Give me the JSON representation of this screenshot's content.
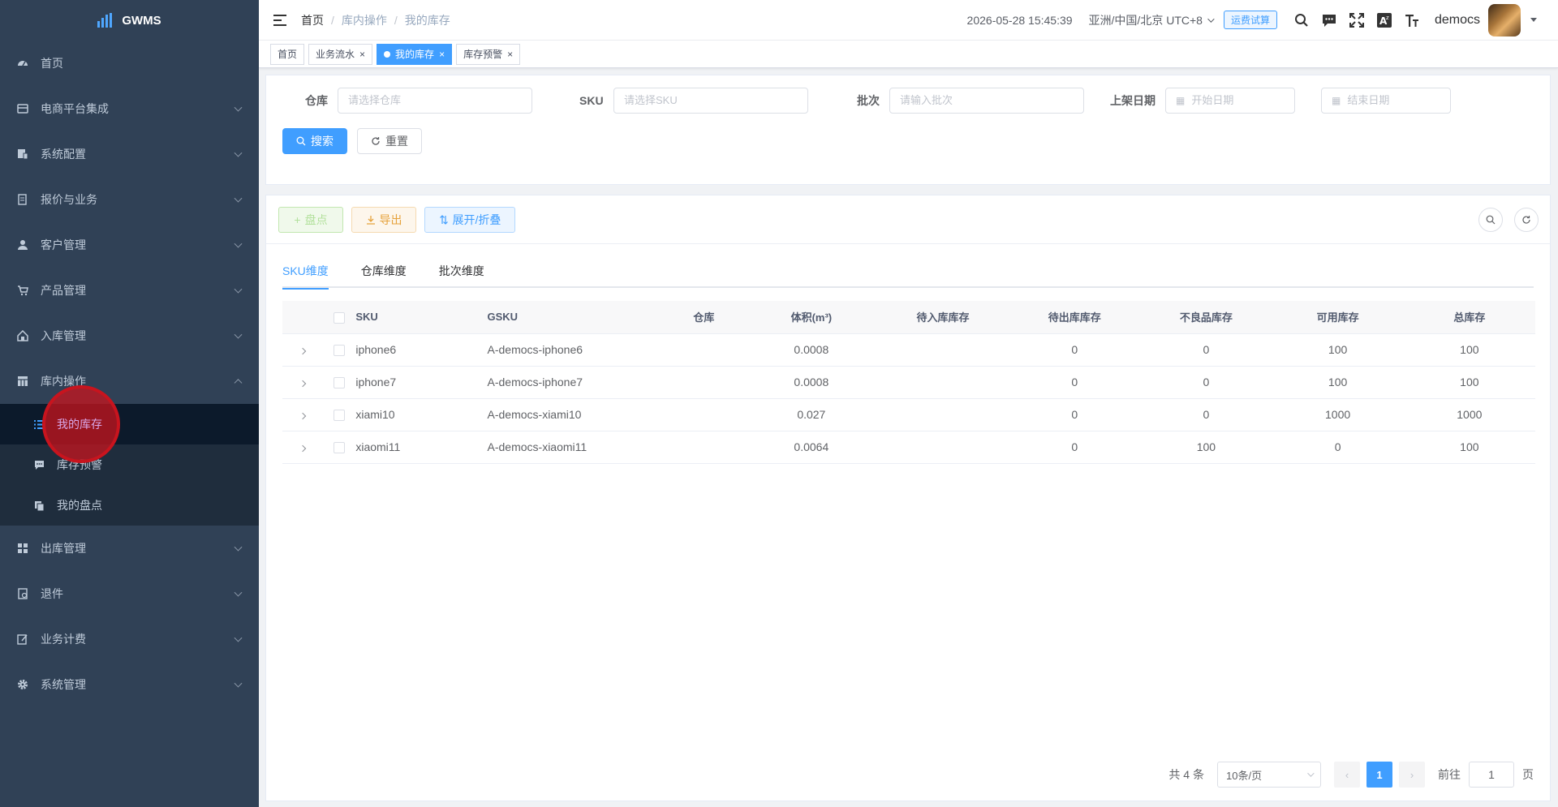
{
  "app": {
    "title": "GWMS"
  },
  "sidebar": {
    "items": [
      {
        "label": "首页",
        "icon": "dashboard-icon"
      },
      {
        "label": "电商平台集成",
        "icon": "shop-icon"
      },
      {
        "label": "系统配置",
        "icon": "config-icon"
      },
      {
        "label": "报价与业务",
        "icon": "quote-icon"
      },
      {
        "label": "客户管理",
        "icon": "user-icon"
      },
      {
        "label": "产品管理",
        "icon": "cart-icon"
      },
      {
        "label": "入库管理",
        "icon": "inbound-icon"
      },
      {
        "label": "库内操作",
        "icon": "table-icon"
      },
      {
        "label": "出库管理",
        "icon": "grid-icon"
      },
      {
        "label": "退件",
        "icon": "return-icon"
      },
      {
        "label": "业务计费",
        "icon": "edit-icon"
      },
      {
        "label": "系统管理",
        "icon": "gear-icon"
      }
    ],
    "submenu": [
      {
        "label": "我的库存",
        "icon": "list-icon",
        "active": true
      },
      {
        "label": "库存预警",
        "icon": "message-icon"
      },
      {
        "label": "我的盘点",
        "icon": "copy-icon"
      }
    ]
  },
  "navbar": {
    "breadcrumb": [
      "首页",
      "库内操作",
      "我的库存"
    ],
    "datetime": "2026-05-28 15:45:39",
    "timezone": "亚洲/中国/北京 UTC+8",
    "fee_button": "运费试算",
    "username": "democs"
  },
  "tags": [
    {
      "label": "首页",
      "closable": false
    },
    {
      "label": "业务流水",
      "closable": true
    },
    {
      "label": "我的库存",
      "closable": true,
      "active": true
    },
    {
      "label": "库存预警",
      "closable": true
    }
  ],
  "filter": {
    "warehouse_label": "仓库",
    "warehouse_placeholder": "请选择仓库",
    "sku_label": "SKU",
    "sku_placeholder": "请选择SKU",
    "batch_label": "批次",
    "batch_placeholder": "请输入批次",
    "date_label": "上架日期",
    "start_placeholder": "开始日期",
    "end_placeholder": "结束日期",
    "search_label": "搜索",
    "reset_label": "重置"
  },
  "toolbar": {
    "count_label": "盘点",
    "export_label": "导出",
    "expand_label": "展开/折叠"
  },
  "tabs": [
    "SKU维度",
    "仓库维度",
    "批次维度"
  ],
  "table": {
    "columns": [
      "SKU",
      "GSKU",
      "仓库",
      "体积(m³)",
      "待入库库存",
      "待出库库存",
      "不良品库存",
      "可用库存",
      "总库存"
    ],
    "rows": [
      {
        "sku": "iphone6",
        "gsku": "A-democs-iphone6",
        "warehouse": "",
        "volume": "0.0008",
        "pending_in": "",
        "pending_out": "0",
        "defective": "0",
        "available": "100",
        "total": "100"
      },
      {
        "sku": "iphone7",
        "gsku": "A-democs-iphone7",
        "warehouse": "",
        "volume": "0.0008",
        "pending_in": "",
        "pending_out": "0",
        "defective": "0",
        "available": "100",
        "total": "100"
      },
      {
        "sku": "xiami10",
        "gsku": "A-democs-xiami10",
        "warehouse": "",
        "volume": "0.027",
        "pending_in": "",
        "pending_out": "0",
        "defective": "0",
        "available": "1000",
        "total": "1000"
      },
      {
        "sku": "xiaomi11",
        "gsku": "A-democs-xiaomi11",
        "warehouse": "",
        "volume": "0.0064",
        "pending_in": "",
        "pending_out": "0",
        "defective": "100",
        "available": "0",
        "total": "100"
      }
    ]
  },
  "pagination": {
    "total_text": "共 4 条",
    "page_size": "10条/页",
    "current_page": "1",
    "goto_label": "前往",
    "goto_value": "1",
    "page_suffix": "页"
  },
  "colors": {
    "sidebar_bg": "#304156",
    "primary": "#409eff",
    "active_sub_bg": "#0c1a2b"
  }
}
